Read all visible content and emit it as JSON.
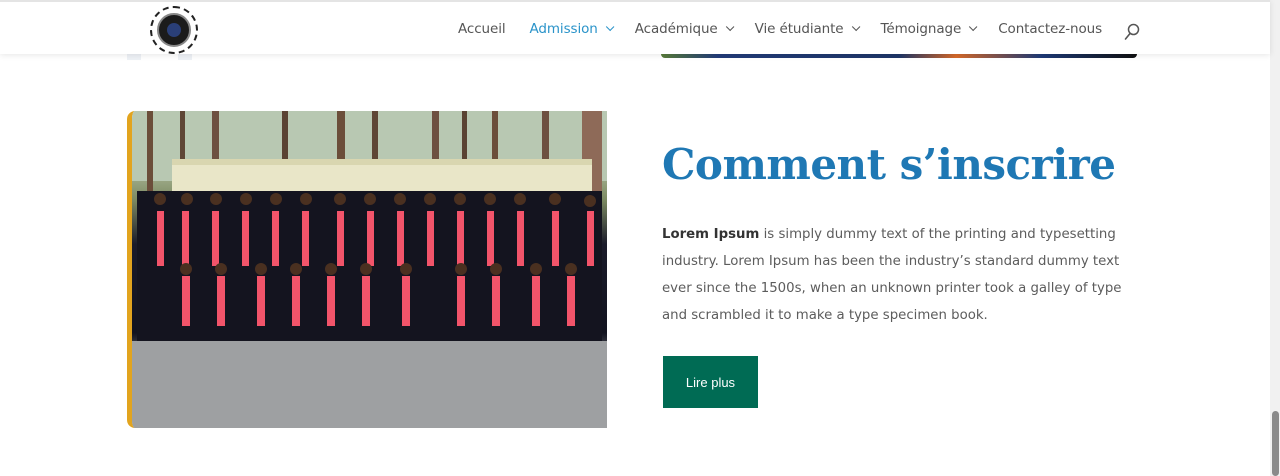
{
  "nav": {
    "items": [
      {
        "label": "Accueil",
        "dropdown": false,
        "active": false
      },
      {
        "label": "Admission",
        "dropdown": true,
        "active": true
      },
      {
        "label": "Académique",
        "dropdown": true,
        "active": false
      },
      {
        "label": "Vie étudiante",
        "dropdown": true,
        "active": false
      },
      {
        "label": "Témoignage",
        "dropdown": true,
        "active": false
      },
      {
        "label": "Contactez-nous",
        "dropdown": false,
        "active": false
      }
    ],
    "search_icon": "search-icon"
  },
  "section": {
    "title": "Comment s’inscrire",
    "body_bold": "Lorem Ipsum",
    "body_rest": " is simply dummy text of the printing and typesetting industry. Lorem Ipsum has been the industry’s standard dummy text ever since the 1500s, when an unknown printer took a galley of type and scrambled it to make a type specimen book.",
    "button_label": "Lire plus"
  },
  "colors": {
    "accent": "#2a93c9",
    "title": "#1f78b4",
    "button": "#006b54",
    "photo_border": "#e2a41e"
  }
}
